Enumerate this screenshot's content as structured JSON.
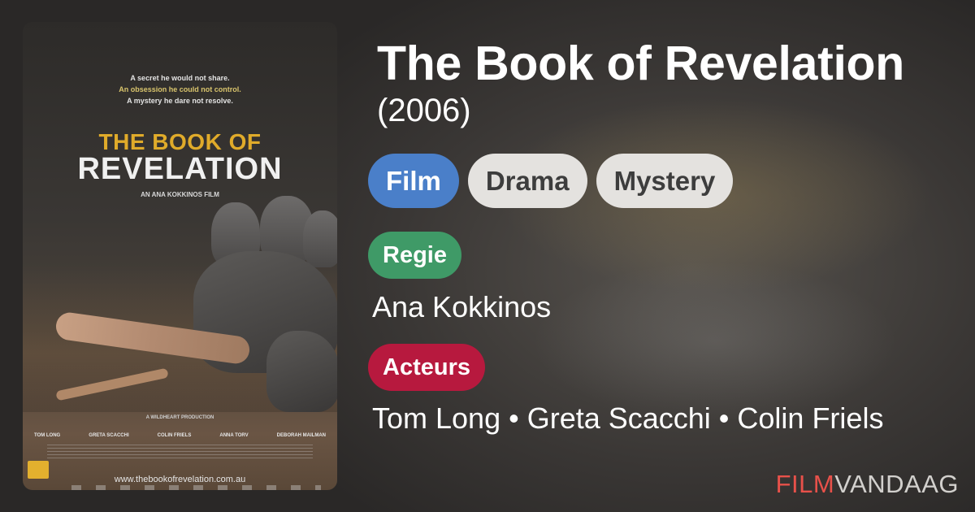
{
  "poster": {
    "tagline_1": "A secret he would not share.",
    "tagline_2": "An obsession he could not control.",
    "tagline_3": "A mystery he dare not resolve.",
    "title_line_1": "THE BOOK OF",
    "title_line_2": "REVELATION",
    "credit": "AN ANA KOKKINOS FILM",
    "production": "A WILDHEART PRODUCTION",
    "cast": [
      "TOM LONG",
      "GRETA SCACCHI",
      "COLIN FRIELS",
      "ANNA TORV",
      "DEBORAH MAILMAN"
    ],
    "website": "www.thebookofrevelation.com.au"
  },
  "movie": {
    "title": "The Book of Revelation",
    "year": "(2006)"
  },
  "chips": {
    "type": "Film",
    "genres": [
      "Drama",
      "Mystery"
    ]
  },
  "director": {
    "label": "Regie",
    "value": "Ana Kokkinos"
  },
  "actors": {
    "label": "Acteurs",
    "value": "Tom Long • Greta Scacchi • Colin Friels"
  },
  "brand": {
    "part_1": "FILM",
    "part_2": "VANDAAG"
  },
  "colors": {
    "film_chip": "#4a7fc9",
    "genre_chip": "#e4e2df",
    "regie_label": "#3f9a67",
    "acteurs_label": "#b7193e",
    "brand_accent": "#e8514a"
  }
}
